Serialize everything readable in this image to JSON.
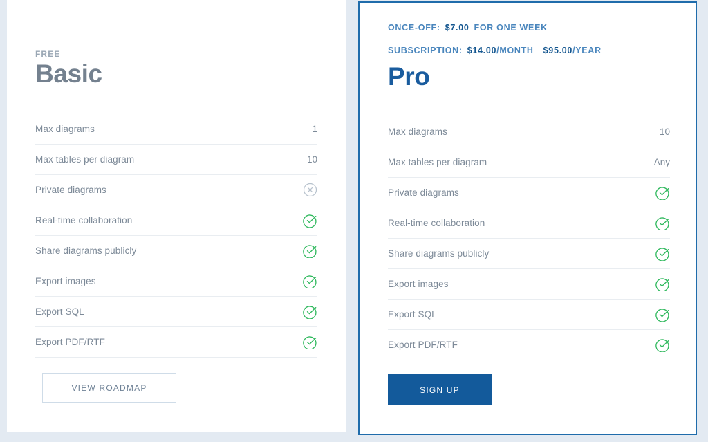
{
  "page": {
    "background_color": "#e3eaf2"
  },
  "plans": [
    {
      "id": "basic",
      "eyebrow": "FREE",
      "title": "Basic",
      "title_color": "#74818f",
      "features": [
        {
          "label": "Max diagrams",
          "value": "1",
          "kind": "text"
        },
        {
          "label": "Max tables per diagram",
          "value": "10",
          "kind": "text"
        },
        {
          "label": "Private diagrams",
          "value": "",
          "kind": "cross",
          "icon": "circle-x-icon"
        },
        {
          "label": "Real-time collaboration",
          "value": "",
          "kind": "check",
          "icon": "circle-check-icon"
        },
        {
          "label": "Share diagrams publicly",
          "value": "",
          "kind": "check",
          "icon": "circle-check-icon"
        },
        {
          "label": "Export images",
          "value": "",
          "kind": "check",
          "icon": "circle-check-icon"
        },
        {
          "label": "Export SQL",
          "value": "",
          "kind": "check",
          "icon": "circle-check-icon"
        },
        {
          "label": "Export PDF/RTF",
          "value": "",
          "kind": "check",
          "icon": "circle-check-icon"
        }
      ],
      "button": {
        "label": "VIEW ROADMAP",
        "style": "outline"
      }
    },
    {
      "id": "pro",
      "title": "Pro",
      "title_color": "#1a5c9e",
      "border_color": "#1f6cab",
      "pricing": {
        "once_off": {
          "label": "ONCE-OFF:",
          "amount": "$7.00",
          "suffix": "FOR ONE WEEK"
        },
        "subscription": {
          "label": "SUBSCRIPTION:",
          "monthly_amount": "$14.00",
          "monthly_suffix": "/MONTH",
          "yearly_amount": "$95.00",
          "yearly_suffix": "/YEAR"
        }
      },
      "features": [
        {
          "label": "Max diagrams",
          "value": "10",
          "kind": "text"
        },
        {
          "label": "Max tables per diagram",
          "value": "Any",
          "kind": "text"
        },
        {
          "label": "Private diagrams",
          "value": "",
          "kind": "check",
          "icon": "circle-check-icon"
        },
        {
          "label": "Real-time collaboration",
          "value": "",
          "kind": "check",
          "icon": "circle-check-icon"
        },
        {
          "label": "Share diagrams publicly",
          "value": "",
          "kind": "check",
          "icon": "circle-check-icon"
        },
        {
          "label": "Export images",
          "value": "",
          "kind": "check",
          "icon": "circle-check-icon"
        },
        {
          "label": "Export SQL",
          "value": "",
          "kind": "check",
          "icon": "circle-check-icon"
        },
        {
          "label": "Export PDF/RTF",
          "value": "",
          "kind": "check",
          "icon": "circle-check-icon"
        }
      ],
      "button": {
        "label": "SIGN UP",
        "style": "solid"
      }
    }
  ],
  "colors": {
    "check_green": "#2eb85c",
    "cross_gray": "#b7c2cd",
    "accent_blue": "#135a9b",
    "label_gray": "#7d8a98",
    "divider": "#e9edf1"
  }
}
